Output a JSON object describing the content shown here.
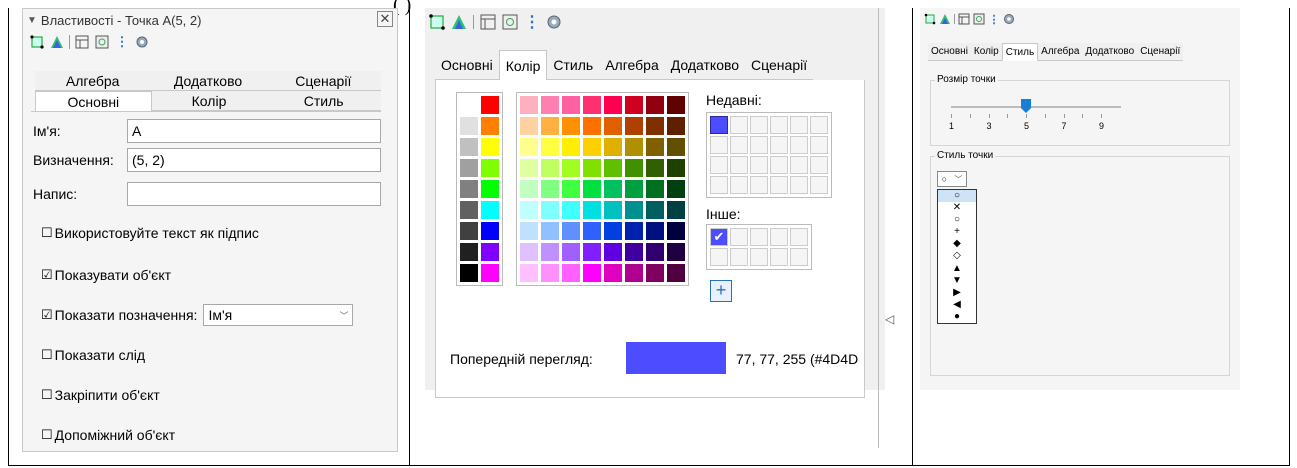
{
  "panel1": {
    "title": "Властивості - Точка A(5, 2)",
    "tabs_row1": [
      "Алгебра",
      "Додатково",
      "Сценарії"
    ],
    "tabs_row2": [
      "Основні",
      "Колір",
      "Стиль"
    ],
    "name_label": "Ім'я:",
    "name_value": "A",
    "definition_label": "Визначення:",
    "definition_value": "(5, 2)",
    "caption_label": "Напис:",
    "caption_value": "",
    "use_text_caption": "Використовуйте текст як підпис",
    "show_object": "Показувати об'єкт",
    "show_label": "Показати позначення:",
    "show_label_value": "Ім'я",
    "show_trace": "Показати слід",
    "fix_object": "Закріпити об'єкт",
    "aux_object": "Допоміжний об'єкт"
  },
  "panel2": {
    "tabs": [
      "Основні",
      "Колір",
      "Стиль",
      "Алгебра",
      "Додатково",
      "Сценарії"
    ],
    "recent_label": "Недавні:",
    "other_label": "Інше:",
    "preview_label": "Попередній перегляд:",
    "preview_value": "77, 77, 255 (#4D4D",
    "preview_color": "#4d4dff",
    "gray_palette": [
      "#ffffff",
      "#ff0000",
      "#e0e0e0",
      "#ff8000",
      "#c0c0c0",
      "#ffff00",
      "#a0a0a0",
      "#80ff00",
      "#808080",
      "#00ff00",
      "#606060",
      "#00ffff",
      "#404040",
      "#0000ff",
      "#202020",
      "#8000ff",
      "#000000",
      "#ff00ff"
    ],
    "main_palette": [
      "#ffb0c0",
      "#ff80b0",
      "#ff60a0",
      "#ff3070",
      "#ff0050",
      "#d00020",
      "#900010",
      "#600000",
      "#ffd0a0",
      "#ffb040",
      "#ff9000",
      "#ff7000",
      "#e06000",
      "#b04000",
      "#803000",
      "#602000",
      "#ffff90",
      "#ffff40",
      "#ffee00",
      "#ffd000",
      "#e0b000",
      "#b09000",
      "#806000",
      "#605000",
      "#e0ffa0",
      "#c0ff60",
      "#a0ff20",
      "#80e000",
      "#60c000",
      "#409000",
      "#306000",
      "#204000",
      "#c0ffc0",
      "#80ff80",
      "#40ff40",
      "#00e040",
      "#00c060",
      "#00a040",
      "#007020",
      "#004010",
      "#c0ffff",
      "#80ffff",
      "#40ffff",
      "#00e0e0",
      "#00c0c0",
      "#009090",
      "#006060",
      "#004040",
      "#c0e0ff",
      "#90c0ff",
      "#6090ff",
      "#3060ff",
      "#0040e0",
      "#0020b0",
      "#001080",
      "#000040",
      "#e0c0ff",
      "#c090ff",
      "#a060ff",
      "#8020ff",
      "#6000e0",
      "#4000a0",
      "#300070",
      "#200040",
      "#ffc0ff",
      "#ff90ff",
      "#ff60ff",
      "#ff00ff",
      "#e000c0",
      "#b00090",
      "#800060",
      "#500040"
    ]
  },
  "panel3": {
    "tabs": [
      "Основні",
      "Колір",
      "Стиль",
      "Алгебра",
      "Додатково",
      "Сценарії"
    ],
    "point_size_label": "Розмір точки",
    "point_size_value": 5,
    "tick_labels": [
      "1",
      "3",
      "5",
      "7",
      "9"
    ],
    "point_style_label": "Стиль точки",
    "style_current": "○",
    "styles": [
      "○",
      "✕",
      "○",
      "+",
      "◆",
      "◇",
      "▲",
      "▼",
      "▶",
      "◀",
      "●"
    ]
  },
  "toolbar_icons": [
    "point-style-icon",
    "color-icon",
    "list-icon",
    "graphics-icon",
    "more-icon",
    "settings-icon"
  ]
}
